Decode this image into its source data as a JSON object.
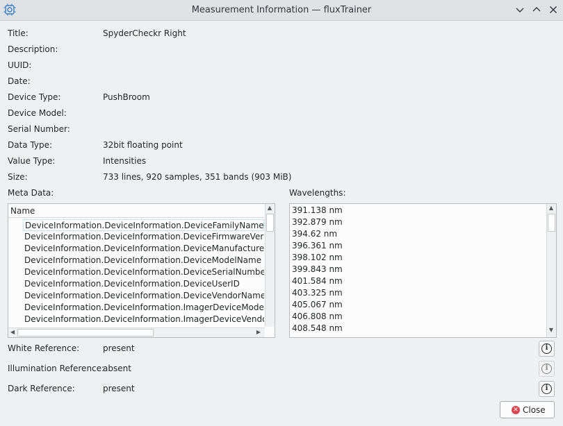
{
  "window": {
    "title": "Measurement Information — fluxTrainer",
    "app_icon": "cpu-gear-icon"
  },
  "fields": [
    {
      "label": "Title:",
      "value": "SpyderCheckr Right"
    },
    {
      "label": "Description:",
      "value": ""
    },
    {
      "label": "UUID:",
      "value": ""
    },
    {
      "label": "Date:",
      "value": ""
    },
    {
      "label": "Device Type:",
      "value": "PushBroom"
    },
    {
      "label": "Device Model:",
      "value": ""
    },
    {
      "label": "Serial Number:",
      "value": ""
    },
    {
      "label": "Data Type:",
      "value": "32bit floating point"
    },
    {
      "label": "Value Type:",
      "value": "Intensities"
    },
    {
      "label": "Size:",
      "value": "733 lines, 920 samples, 351 bands (903 MiB)"
    }
  ],
  "meta": {
    "label": "Meta Data:",
    "column": "Name",
    "rows": [
      "DeviceInformation.DeviceInformation.DeviceFamilyName",
      "DeviceInformation.DeviceInformation.DeviceFirmwareVersion",
      "DeviceInformation.DeviceInformation.DeviceManufacturerInfo",
      "DeviceInformation.DeviceInformation.DeviceModelName",
      "DeviceInformation.DeviceInformation.DeviceSerialNumber",
      "DeviceInformation.DeviceInformation.DeviceUserID",
      "DeviceInformation.DeviceInformation.DeviceVendorName",
      "DeviceInformation.DeviceInformation.ImagerDeviceModelName",
      "DeviceInformation.DeviceInformation.ImagerDeviceVendorName"
    ]
  },
  "wavelengths": {
    "label": "Wavelengths:",
    "items": [
      "391.138 nm",
      "392.879 nm",
      "394.62 nm",
      "396.361 nm",
      "398.102 nm",
      "399.843 nm",
      "401.584 nm",
      "403.325 nm",
      "405.067 nm",
      "406.808 nm",
      "408.548 nm"
    ]
  },
  "references": [
    {
      "label": "White Reference:",
      "value": "present",
      "enabled": true
    },
    {
      "label": "Illumination Reference:",
      "value": "absent",
      "enabled": false
    },
    {
      "label": "Dark Reference:",
      "value": "present",
      "enabled": true
    }
  ],
  "close_label": "Close"
}
